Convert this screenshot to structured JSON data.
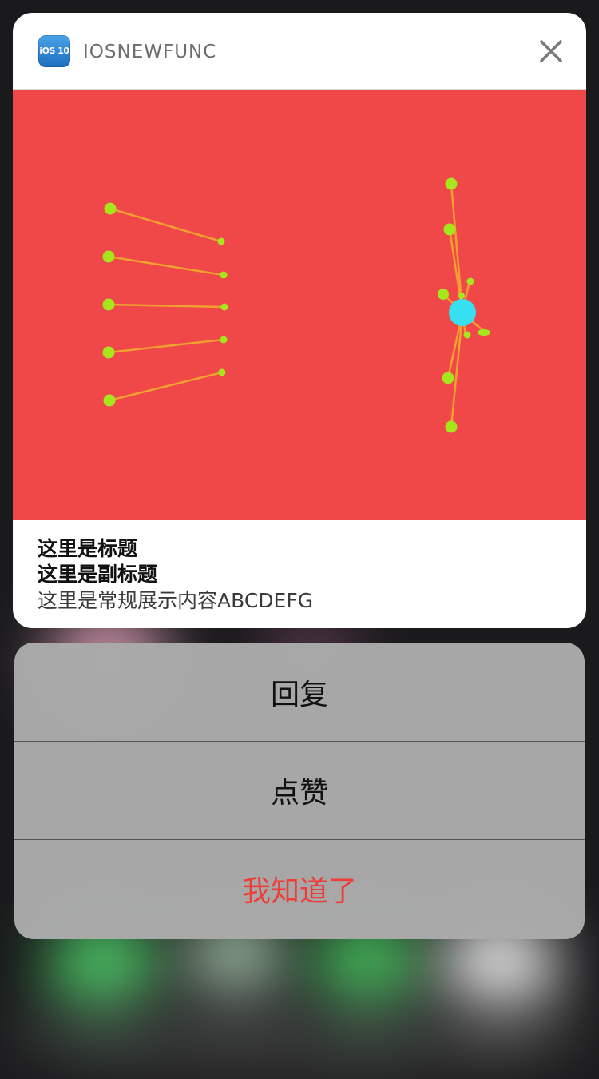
{
  "notification": {
    "app_name": "IOSNEWFUNC",
    "app_icon_label": "iOS 10",
    "close_icon": "close-icon",
    "title": "这里是标题",
    "subtitle": "这里是副标题",
    "body": "这里是常规展示内容ABCDEFG"
  },
  "actions": [
    {
      "label": "回复",
      "style": "default"
    },
    {
      "label": "点赞",
      "style": "default"
    },
    {
      "label": "我知道了",
      "style": "destructive"
    }
  ],
  "colors": {
    "media_background": "#f04848",
    "node": "#a6e61c",
    "hub": "#36e0f0",
    "line": "#f0a030",
    "destructive": "#ef3e3a"
  }
}
